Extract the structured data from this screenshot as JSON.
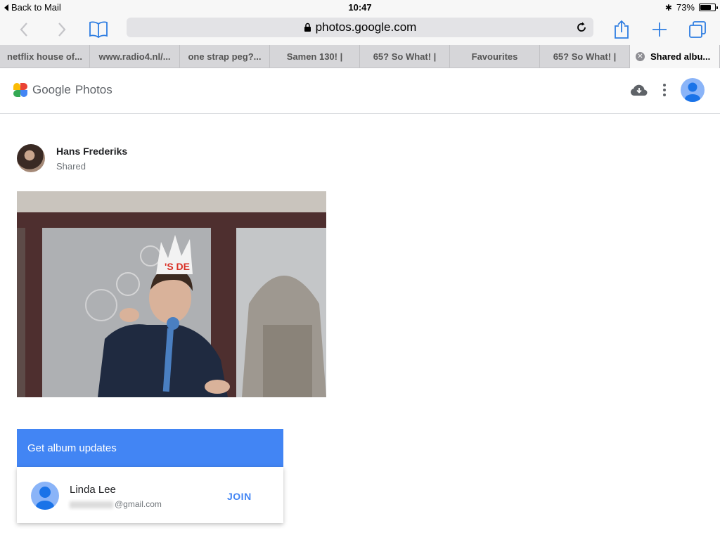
{
  "status_bar": {
    "back_label": "Back to Mail",
    "time": "10:47",
    "battery_text": "73%",
    "battery_level": 0.73
  },
  "browser": {
    "url": "photos.google.com",
    "tabs": [
      {
        "label": "netflix house of..."
      },
      {
        "label": "www.radio4.nl/..."
      },
      {
        "label": "one strap peg?..."
      },
      {
        "label": "Samen 130! |"
      },
      {
        "label": "65? So What! |"
      },
      {
        "label": "Favourites"
      },
      {
        "label": "65? So What! |"
      },
      {
        "label": "Shared albu..."
      }
    ],
    "active_tab_index": 7
  },
  "header": {
    "logo_google": "Google",
    "logo_photos": "Photos"
  },
  "owner": {
    "name": "Hans Frederiks",
    "status": "Shared"
  },
  "updates": {
    "title": "Get album updates",
    "user_name": "Linda Lee",
    "email_suffix": "@gmail.com",
    "join_label": "JOIN"
  },
  "colors": {
    "accent": "#4285f4",
    "avatar_blue": "#8ab4f8"
  }
}
